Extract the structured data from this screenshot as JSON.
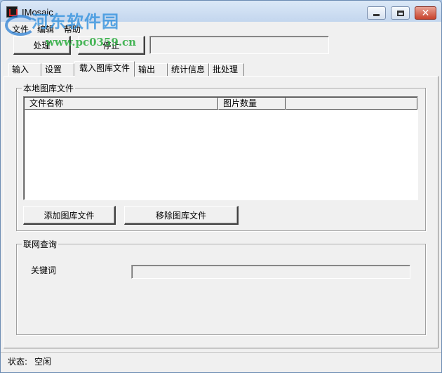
{
  "window": {
    "title": "IMosaic",
    "watermark_text": "河东软件园",
    "watermark_url": "www.pc0359.cn"
  },
  "menu": {
    "items": [
      {
        "label": "文件"
      },
      {
        "label": "编辑"
      },
      {
        "label": "帮助"
      }
    ]
  },
  "toolbar": {
    "process_label": "处理",
    "stop_label": "停止",
    "progress_value": ""
  },
  "tabs": [
    {
      "label": "输入"
    },
    {
      "label": "设置"
    },
    {
      "label": "载入图库文件",
      "active": true
    },
    {
      "label": "输出"
    },
    {
      "label": "统计信息"
    },
    {
      "label": "批处理"
    }
  ],
  "local_library": {
    "group_title": "本地图库文件",
    "columns": [
      "文件名称",
      "图片数量"
    ],
    "rows": [],
    "add_button": "添加图库文件",
    "remove_button": "移除图库文件"
  },
  "online_query": {
    "group_title": "联网查询",
    "keyword_label": "关键词",
    "keyword_value": ""
  },
  "status": {
    "label": "状态:",
    "value": "空闲"
  },
  "colors": {
    "titlebar": "#c3d6ee",
    "close_button": "#c8432d",
    "window_bg": "#f0f0f0"
  }
}
